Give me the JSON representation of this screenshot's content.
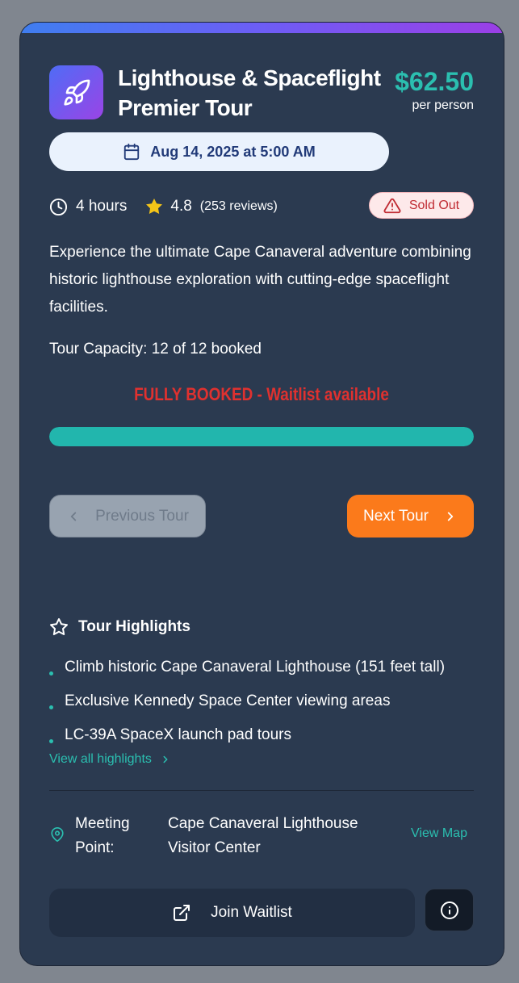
{
  "tour": {
    "icon": "rocket-icon",
    "title": "Lighthouse & Spaceflight Premier Tour",
    "price": "$62.50",
    "price_unit": "per person",
    "date": "Aug 14, 2025 at 5:00 AM",
    "duration": "4 hours",
    "rating": "4.8",
    "reviews": "(253 reviews)",
    "status": "Sold Out",
    "description": "Experience the ultimate Cape Canaveral adventure combining historic lighthouse exploration with cutting-edge spaceflight facilities.",
    "capacity_text": "Tour Capacity: 12 of 12 booked",
    "booked": 12,
    "capacity": 12,
    "fully_booked_text": "FULLY BOOKED - Waitlist available",
    "progress_fraction": 1.0
  },
  "nav": {
    "prev_label": "Previous Tour",
    "prev_disabled": true,
    "next_label": "Next Tour"
  },
  "highlights": {
    "title": "Tour Highlights",
    "items": [
      "Climb historic Cape Canaveral Lighthouse (151 feet tall)",
      "Exclusive Kennedy Space Center viewing areas",
      "LC-39A SpaceX launch pad tours"
    ],
    "view_all_label": "View all highlights"
  },
  "meeting": {
    "label": "Meeting Point:",
    "place": "Cape Canaveral Lighthouse Visitor Center",
    "map_link": "View Map"
  },
  "actions": {
    "waitlist_label": "Join Waitlist",
    "info_icon": "info-icon"
  },
  "colors": {
    "card_bg": "#2b3a50",
    "accent_teal": "#2bbfb0",
    "next_orange": "#fb7a1b",
    "sold_out_red": "#c02b33",
    "fully_booked_red": "#e0312f",
    "star_yellow": "#f5c518"
  }
}
